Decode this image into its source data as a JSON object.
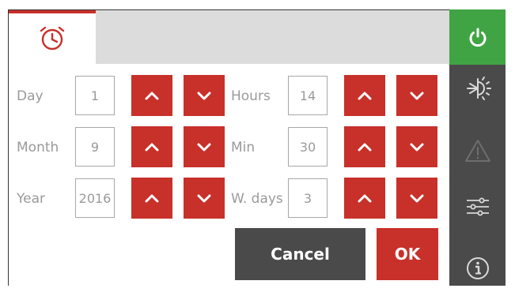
{
  "tabs": [
    {
      "name": "clock",
      "active": true
    }
  ],
  "fields": {
    "day": {
      "label": "Day",
      "value": "1"
    },
    "month": {
      "label": "Month",
      "value": "9"
    },
    "year": {
      "label": "Year",
      "value": "2016"
    },
    "hours": {
      "label": "Hours",
      "value": "14"
    },
    "min": {
      "label": "Min",
      "value": "30"
    },
    "wdays": {
      "label": "W. days",
      "value": "3"
    }
  },
  "actions": {
    "cancel": "Cancel",
    "ok": "OK"
  },
  "sidebar": {
    "items": [
      {
        "icon": "power-icon"
      },
      {
        "icon": "sun-snowflake-icon"
      },
      {
        "icon": "warning-icon"
      },
      {
        "icon": "settings-sliders-icon"
      },
      {
        "icon": "info-icon"
      }
    ]
  },
  "colors": {
    "accent_red": "#c8302a",
    "active_green": "#41a444",
    "sidebar_gray": "#4a4a4a",
    "tab_fill": "#dcdcdc",
    "label_gray": "#9a9a9a"
  }
}
